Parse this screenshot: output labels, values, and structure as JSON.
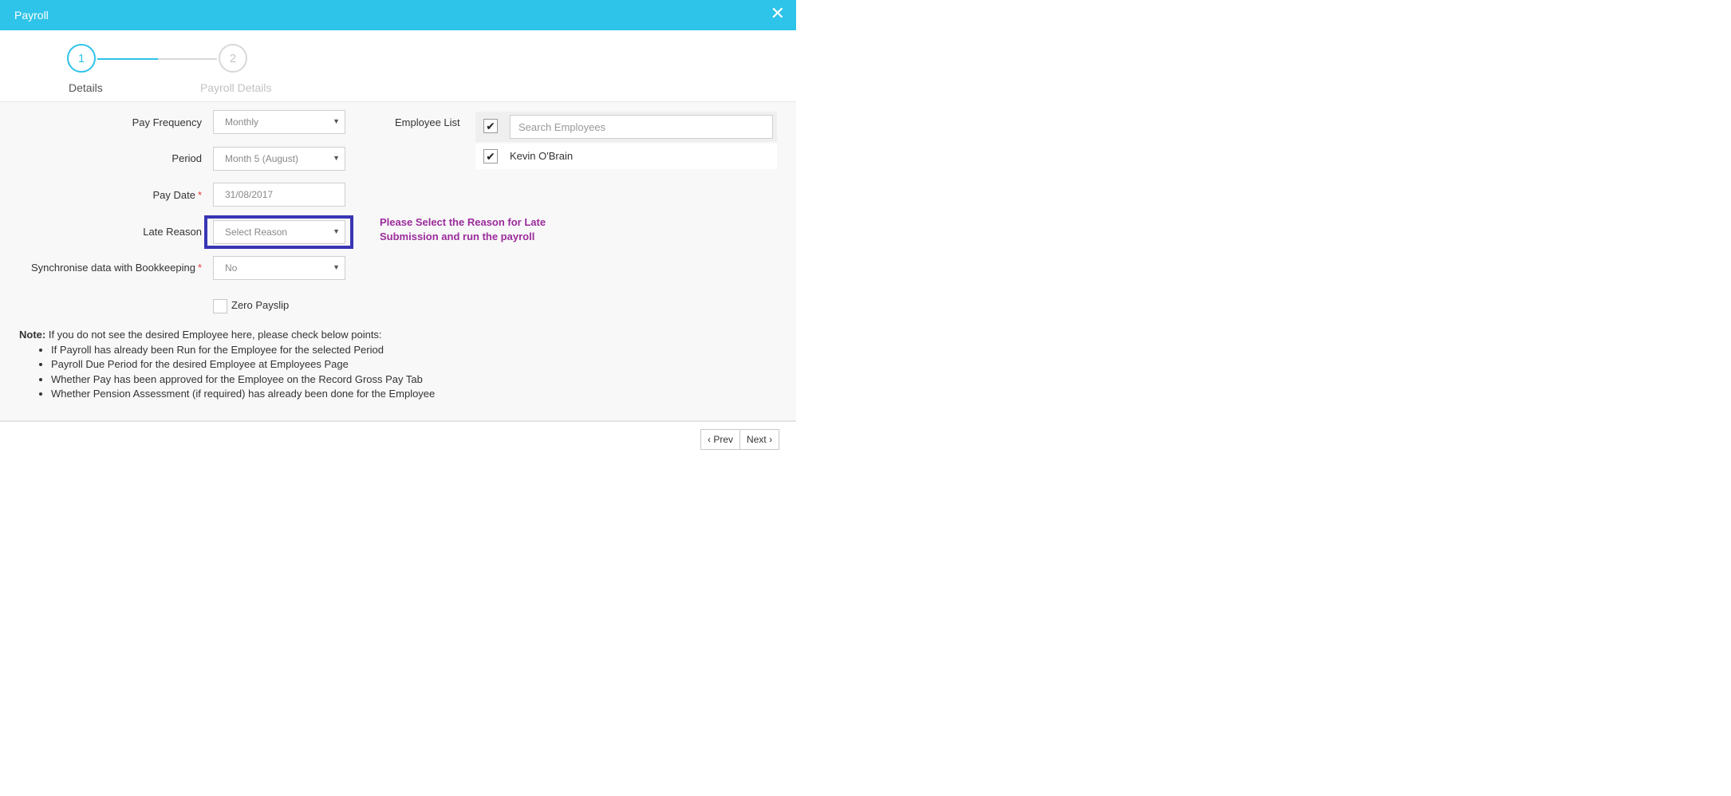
{
  "modal": {
    "title": "Payroll",
    "close_icon": "close-icon"
  },
  "wizard": {
    "steps": [
      {
        "number": "1",
        "label": "Details",
        "state": "active"
      },
      {
        "number": "2",
        "label": "Payroll Details",
        "state": "inactive"
      }
    ],
    "active_color": "#2ec3e9"
  },
  "form": {
    "pay_frequency": {
      "label": "Pay Frequency",
      "value": "Monthly"
    },
    "period": {
      "label": "Period",
      "value": "Month 5 (August)"
    },
    "pay_date": {
      "label": "Pay Date",
      "value": "31/08/2017",
      "required": "*"
    },
    "late_reason": {
      "label": "Late Reason",
      "placeholder": "Select Reason"
    },
    "sync_bookkeeping": {
      "label": "Synchronise data with Bookkeeping",
      "value": "No",
      "required": "*"
    },
    "zero_payslip": {
      "label": "Zero Payslip",
      "checked": false
    }
  },
  "hint": {
    "text": "Please Select the Reason for Late Submission and run the payroll",
    "color": "#9b2c9b",
    "highlight_color": "#3935b3"
  },
  "employee_list": {
    "label": "Employee List",
    "search_placeholder": "Search Employees",
    "select_all_checked": true,
    "employees": [
      {
        "name": "Kevin O'Brain",
        "checked": true
      }
    ]
  },
  "note": {
    "title": "Note:",
    "intro": "If you do not see the desired Employee here, please check below points:",
    "points": [
      "If Payroll has already been Run for the Employee for the selected Period",
      "Payroll Due Period for the desired Employee at Employees Page",
      "Whether Pay has been approved for the Employee on the Record Gross Pay Tab",
      "Whether Pension Assessment (if required) has already been done for the Employee"
    ]
  },
  "footer": {
    "prev_label": "Prev",
    "next_label": "Next"
  }
}
